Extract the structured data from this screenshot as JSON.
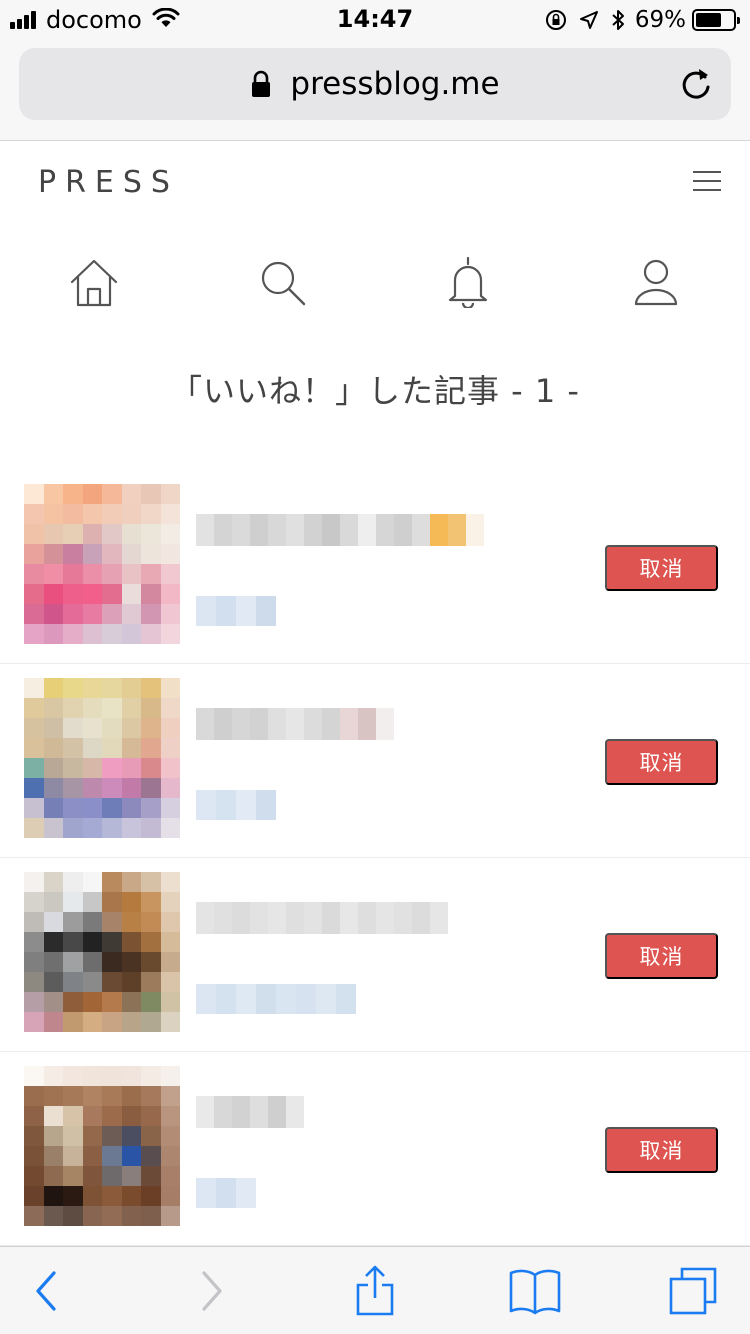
{
  "status_bar": {
    "carrier": "docomo",
    "time": "14:47",
    "battery_percent": "69%",
    "battery_level": 0.69,
    "icons": [
      "signal-icon",
      "wifi-icon",
      "orientation-lock-icon",
      "location-arrow-icon",
      "bluetooth-icon",
      "battery-icon"
    ]
  },
  "browser": {
    "url": "pressblog.me",
    "icons": [
      "lock-icon",
      "reload-icon"
    ]
  },
  "site": {
    "logo": "PRESS",
    "nav": [
      {
        "name": "home",
        "icon": "home-icon"
      },
      {
        "name": "search",
        "icon": "search-icon"
      },
      {
        "name": "notifications",
        "icon": "bell-icon"
      },
      {
        "name": "profile",
        "icon": "user-icon"
      }
    ]
  },
  "page": {
    "title": "「いいね！」した記事 - 1 -"
  },
  "articles": [
    {
      "cancel_label": "取消"
    },
    {
      "cancel_label": "取消"
    },
    {
      "cancel_label": "取消"
    },
    {
      "cancel_label": "取消"
    }
  ],
  "toolbar": {
    "icons": [
      "back-icon",
      "forward-icon",
      "share-icon",
      "bookmarks-icon",
      "tabs-icon"
    ]
  },
  "colors": {
    "accent_blue": "#1a7cf0",
    "cancel_button": "#de5450",
    "text_dark": "#444444"
  }
}
